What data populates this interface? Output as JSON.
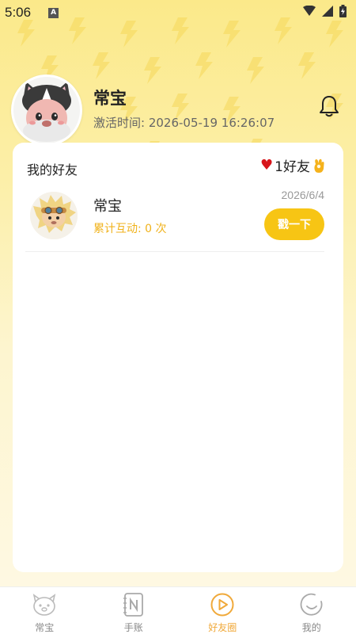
{
  "status_bar": {
    "time": "5:06",
    "notification_glyph": "A"
  },
  "profile": {
    "name": "常宝",
    "activation_label": "激活时间:",
    "activation_time": "2026-05-19 16:26:07"
  },
  "friends_card": {
    "title": "我的好友",
    "count_text": "1好友",
    "friends": [
      {
        "name": "常宝",
        "interactions": "累计互动: 0 次",
        "date": "2026/6/4",
        "action_label": "戳一下"
      }
    ]
  },
  "tab_bar": {
    "tabs": [
      {
        "label": "常宝",
        "icon": "pet-icon"
      },
      {
        "label": "手账",
        "icon": "notebook-icon"
      },
      {
        "label": "好友圈",
        "icon": "play-circle-icon",
        "active": true
      },
      {
        "label": "我的",
        "icon": "smile-icon"
      }
    ]
  },
  "colors": {
    "accent": "#f7c514",
    "interaction_text": "#f0b21b",
    "active_tab": "#f0a93a"
  }
}
